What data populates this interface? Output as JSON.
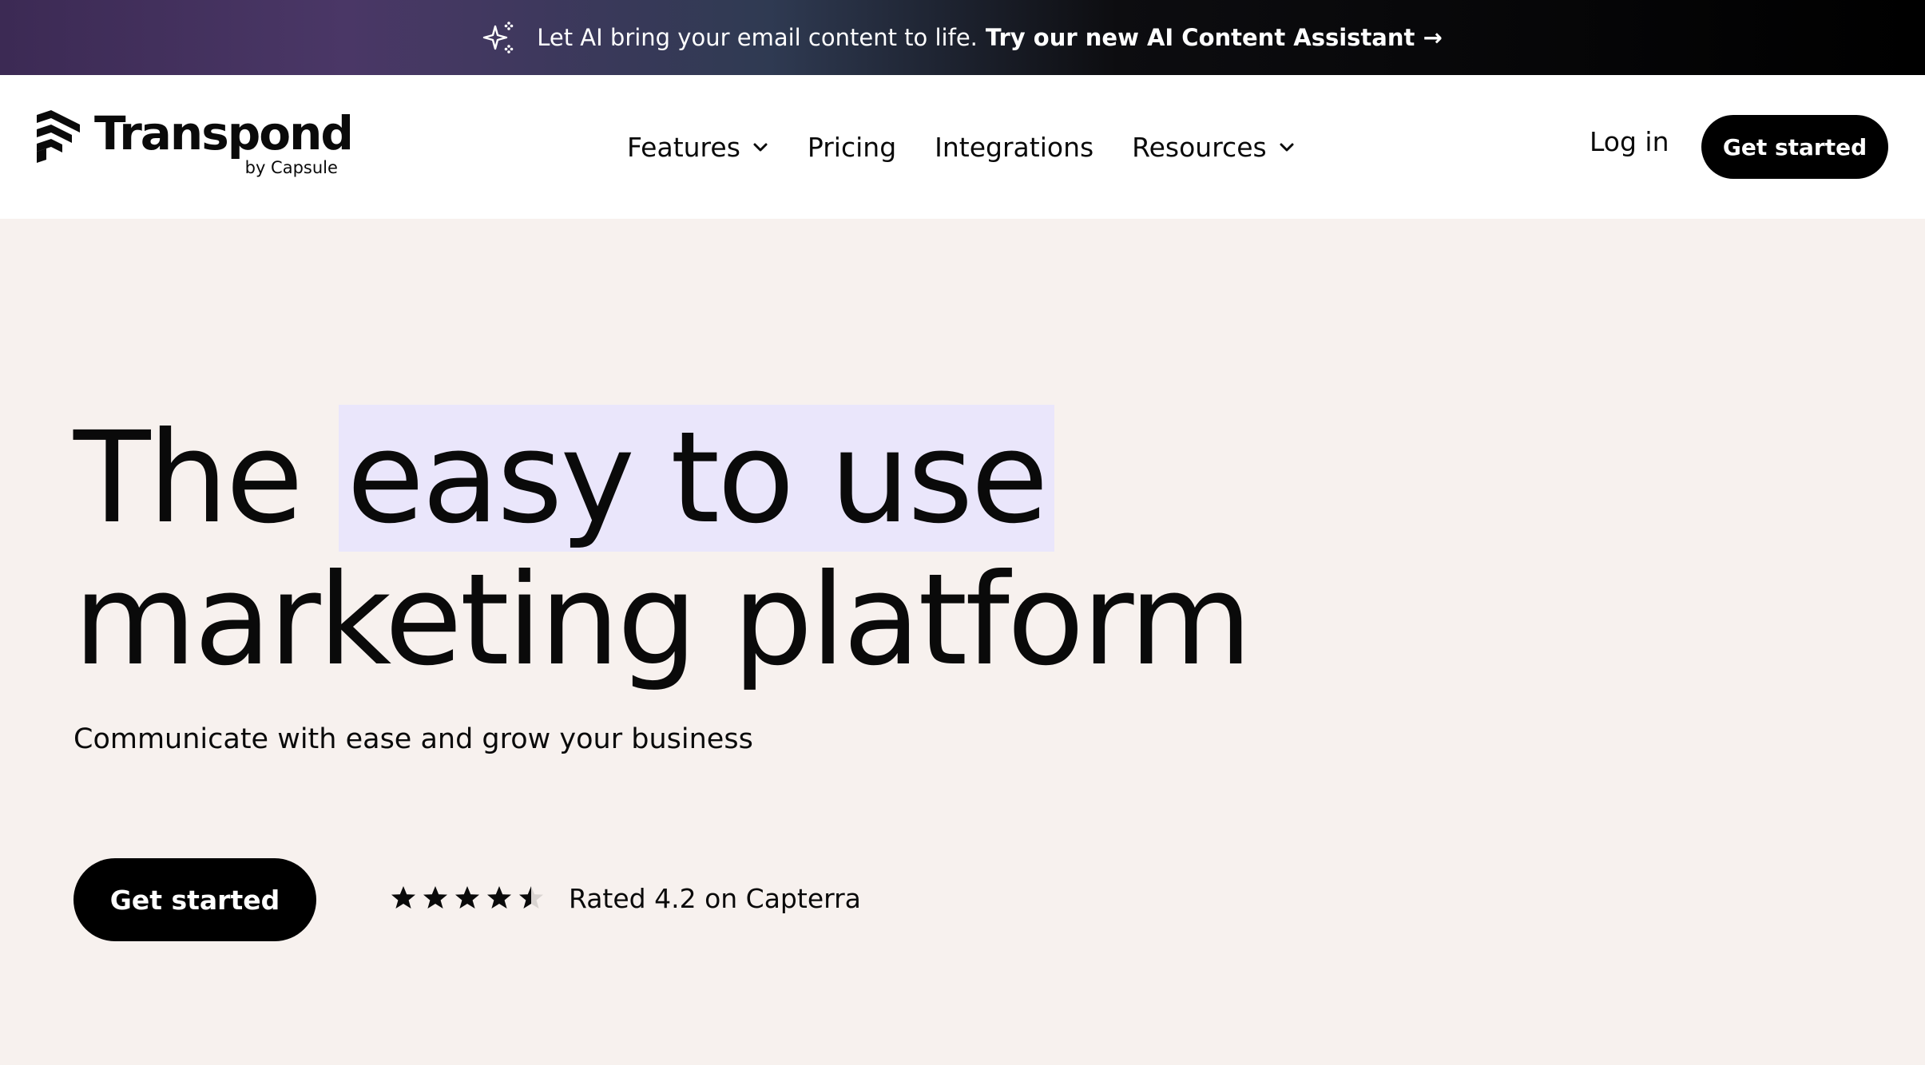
{
  "banner": {
    "icon": "sparkle-icon",
    "lead": "Let AI bring your email content to life.",
    "link": "Try our new AI Content Assistant →"
  },
  "header": {
    "brand": "Transpond",
    "brand_sub": "by Capsule",
    "nav": [
      {
        "label": "Features",
        "has_dropdown": true
      },
      {
        "label": "Pricing",
        "has_dropdown": false
      },
      {
        "label": "Integrations",
        "has_dropdown": false
      },
      {
        "label": "Resources",
        "has_dropdown": true
      }
    ],
    "login": "Log in",
    "cta": "Get started"
  },
  "hero": {
    "title_start": "The",
    "title_highlight": "easy to use",
    "title_end": "marketing platform",
    "subtitle": "Communicate with ease and grow your business",
    "cta": "Get started",
    "rating": {
      "stars_value": 4.2,
      "stars_max": 5,
      "text": "Rated 4.2 on Capterra"
    }
  },
  "colors": {
    "background": "#f7f1ee",
    "highlight": "#eae6fb",
    "button": "#000000",
    "text": "#0a0a0a"
  }
}
